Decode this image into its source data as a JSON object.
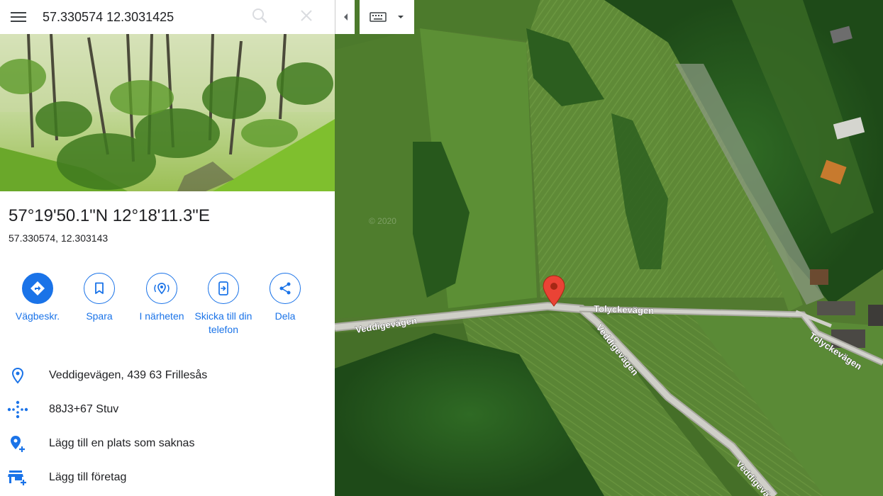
{
  "search": {
    "value": "57.330574 12.3031425"
  },
  "place": {
    "title": "57°19'50.1\"N 12°18'11.3\"E",
    "decimal": "57.330574, 12.303143"
  },
  "actions": [
    {
      "label": "Vägbeskr.",
      "icon": "directions-icon"
    },
    {
      "label": "Spara",
      "icon": "bookmark-icon"
    },
    {
      "label": "I närheten",
      "icon": "nearby-icon"
    },
    {
      "label": "Skicka till din telefon",
      "icon": "send-to-phone-icon"
    },
    {
      "label": "Dela",
      "icon": "share-icon"
    }
  ],
  "info": {
    "address": "Veddigevägen, 439 63 Frillesås",
    "plus_code": "88J3+67 Stuv",
    "add_place": "Lägg till en plats som saknas",
    "add_business": "Lägg till företag"
  },
  "map": {
    "roads": [
      "Veddigevägen",
      "Tolyckevägen",
      "Veddigevägen",
      "Tolyckevägen",
      "Veddigevägen"
    ],
    "watermark": "© 2020"
  },
  "colors": {
    "accent": "#1a73e8",
    "pin": "#ea4335"
  }
}
